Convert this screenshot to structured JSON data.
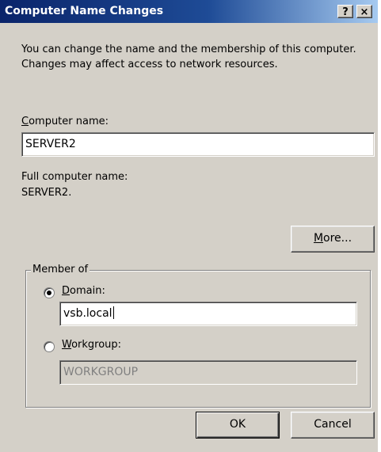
{
  "window": {
    "title": "Computer Name Changes",
    "help_glyph": "?",
    "close_glyph": "×"
  },
  "intro_text": "You can change the name and the membership of this computer. Changes may affect access to network resources.",
  "computer_name": {
    "label_accel": "C",
    "label_rest": "omputer name:",
    "value": "SERVER2"
  },
  "full_name": {
    "label": "Full computer name:",
    "value": "SERVER2."
  },
  "more_button": {
    "accel": "M",
    "rest": "ore..."
  },
  "member_of": {
    "legend": "Member of",
    "domain": {
      "accel": "D",
      "rest": "omain:",
      "selected": true,
      "value": "vsb.local"
    },
    "workgroup": {
      "accel": "W",
      "rest": "orkgroup:",
      "selected": false,
      "value": "WORKGROUP"
    }
  },
  "buttons": {
    "ok": "OK",
    "cancel": "Cancel"
  }
}
